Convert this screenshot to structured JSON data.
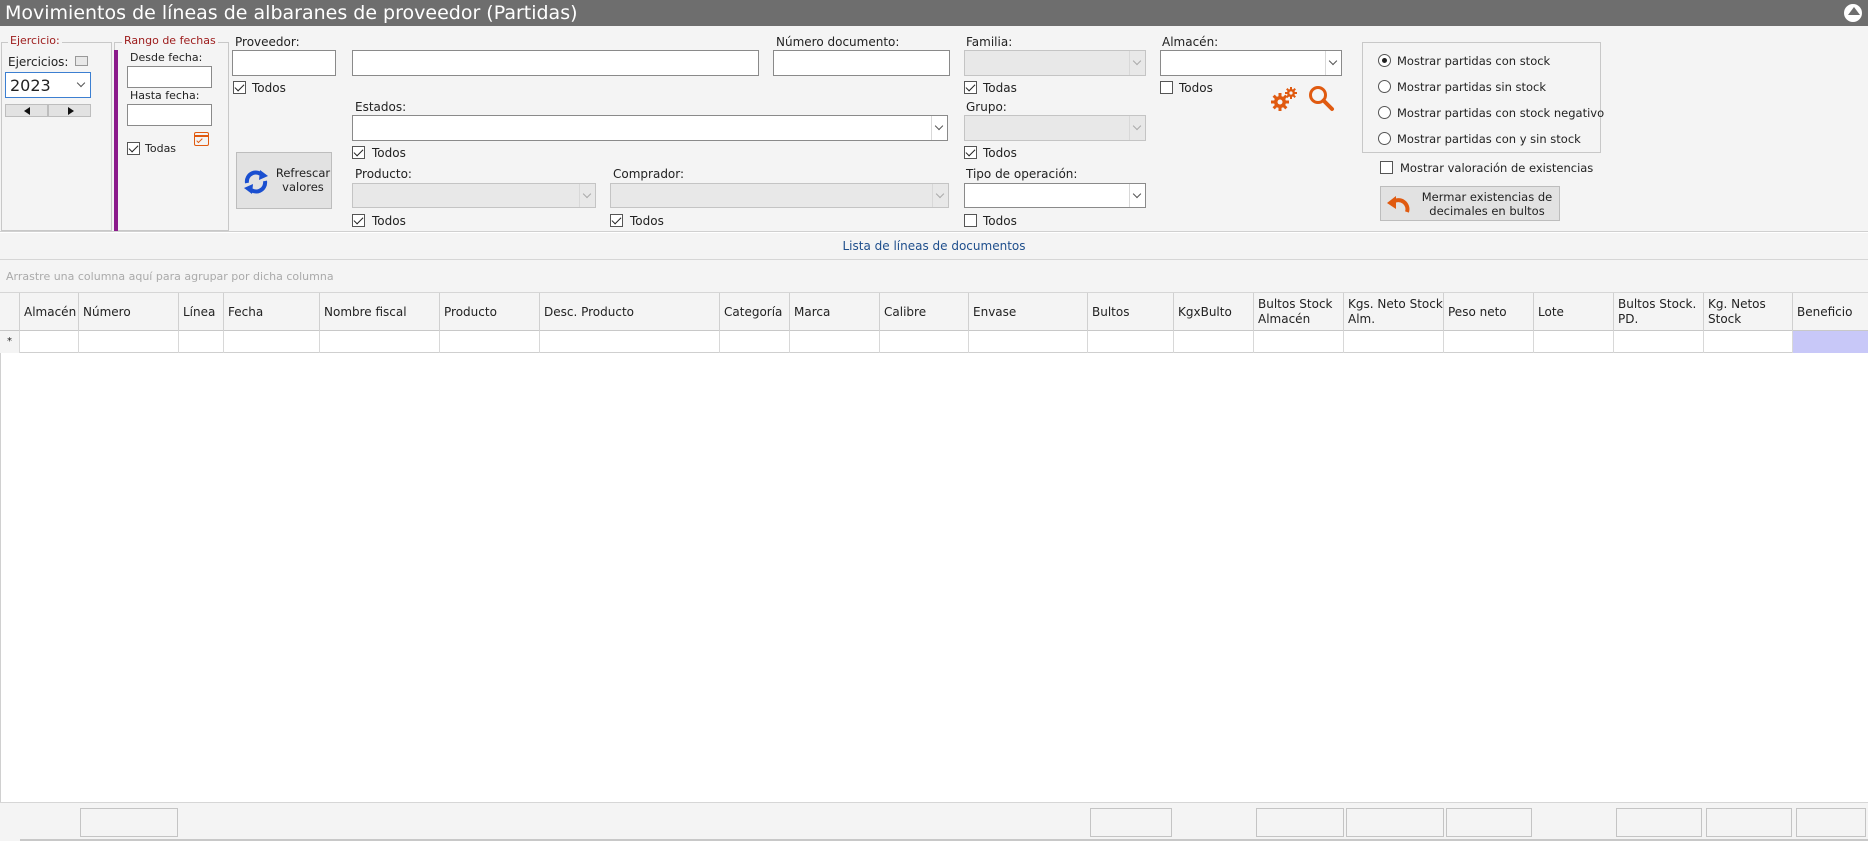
{
  "window": {
    "title": "Movimientos de líneas de albaranes de proveedor (Partidas)"
  },
  "ejercicio": {
    "legend": "Ejercicio:",
    "label": "Ejercicios:",
    "value": "2023"
  },
  "fechas": {
    "legend": "Rango de fechas",
    "desde_label": "Desde fecha:",
    "desde_value": "",
    "hasta_label": "Hasta fecha:",
    "hasta_value": "",
    "todas_label": "Todas",
    "todas_checked": true
  },
  "proveedor": {
    "label": "Proveedor:",
    "code_value": "",
    "name_value": "",
    "todos_label": "Todos",
    "todos_checked": true
  },
  "numero_documento": {
    "label": "Número documento:",
    "value": ""
  },
  "familia": {
    "label": "Familia:",
    "value": "",
    "todas_label": "Todas",
    "todas_checked": true
  },
  "almacen": {
    "label": "Almacén:",
    "value": "",
    "todos_label": "Todos",
    "todos_checked": false
  },
  "estados": {
    "label": "Estados:",
    "value": "",
    "todos_label": "Todos",
    "todos_checked": true
  },
  "grupo": {
    "label": "Grupo:",
    "value": "",
    "todos_label": "Todos",
    "todos_checked": true
  },
  "refresh_button": {
    "label": "Refrescar valores"
  },
  "producto": {
    "label": "Producto:",
    "value": "",
    "todos_label": "Todos",
    "todos_checked": true
  },
  "comprador": {
    "label": "Comprador:",
    "value": "",
    "todos_label": "Todos",
    "todos_checked": true
  },
  "tipo_operacion": {
    "label": "Tipo de operación:",
    "value": "",
    "todos_label": "Todos",
    "todos_checked": false
  },
  "stock_options": {
    "options": [
      "Mostrar partidas con stock",
      "Mostrar partidas sin stock",
      "Mostrar partidas con stock negativo",
      "Mostrar partidas con y sin stock"
    ],
    "selected": 0
  },
  "valoracion": {
    "label": "Mostrar valoración de existencias",
    "checked": false
  },
  "mermar_button": {
    "label": "Mermar existencias de decimales en bultos"
  },
  "grid": {
    "caption": "Lista de líneas de documentos",
    "group_hint": "Arrastre una columna aquí para agrupar por dicha columna",
    "columns": [
      "Almacén",
      "Número",
      "Línea",
      "Fecha",
      "Nombre fiscal",
      "Producto",
      "Desc. Producto",
      "Categoría",
      "Marca",
      "Calibre",
      "Envase",
      "Bultos",
      "KgxBulto",
      "Bultos Stock Almacén",
      "Kgs. Neto Stock Alm.",
      "Peso neto",
      "Lote",
      "Bultos Stock. PD.",
      "Kg. Netos Stock",
      "Beneficio"
    ],
    "new_row_marker": "*"
  },
  "colors": {
    "title_bar": "#6e6e6e",
    "legend_text": "#9c1a1a",
    "accent_bar": "#8b1a8b",
    "caption_text": "#1e4e8c",
    "highlight_cell": "#c8c8f8",
    "icon_orange": "#e05a10"
  }
}
